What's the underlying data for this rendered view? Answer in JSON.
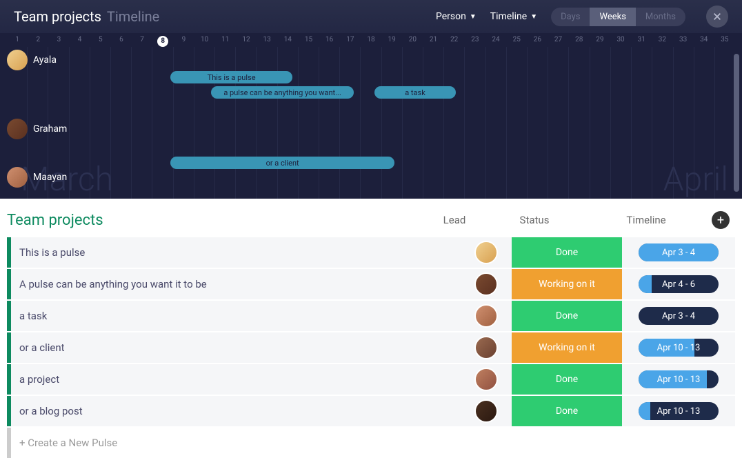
{
  "header": {
    "title": "Team projects",
    "subtitle": "Timeline",
    "dropdowns": {
      "person": "Person",
      "timeline": "Timeline"
    },
    "zoom": {
      "days": "Days",
      "weeks": "Weeks",
      "months": "Months",
      "active": "weeks"
    }
  },
  "timeline": {
    "days_start": 1,
    "days_end": 35,
    "current_day": 8,
    "left_month": "March",
    "right_month": "April",
    "people": [
      {
        "name": "Ayala"
      },
      {
        "name": "Graham"
      },
      {
        "name": "Maayan"
      }
    ],
    "bars": [
      {
        "label": "This is a pulse",
        "start": 9,
        "end": 15,
        "row": 0
      },
      {
        "label": "a pulse can be anything you want...",
        "start": 11,
        "end": 18,
        "row": 1
      },
      {
        "label": "a task",
        "start": 19,
        "end": 23,
        "row": 1
      },
      {
        "label": "or a client",
        "start": 9,
        "end": 20,
        "row": 3
      }
    ]
  },
  "board": {
    "title": "Team projects",
    "columns": {
      "lead": "Lead",
      "status": "Status",
      "timeline": "Timeline"
    },
    "rows": [
      {
        "title": "This is a pulse",
        "status_label": "Done",
        "status": "done",
        "date": "Apr 3 - 4",
        "progress": 100,
        "avatar": "av1"
      },
      {
        "title": "A pulse can be anything you want it to be",
        "status_label": "Working on it",
        "status": "working",
        "date": "Apr 4 - 6",
        "progress": 16,
        "avatar": "av2"
      },
      {
        "title": "a task",
        "status_label": "Done",
        "status": "done",
        "date": "Apr 3 - 4",
        "progress": 0,
        "avatar": "av3"
      },
      {
        "title": "or a client",
        "status_label": "Working on it",
        "status": "working",
        "date": "Apr 10 - 13",
        "progress": 70,
        "avatar": "av4"
      },
      {
        "title": "a project",
        "status_label": "Done",
        "status": "done",
        "date": "Apr 10 - 13",
        "progress": 85,
        "avatar": "av5"
      },
      {
        "title": "or a blog post",
        "status_label": "Done",
        "status": "done",
        "date": "Apr 10 - 13",
        "progress": 15,
        "avatar": "av6"
      }
    ],
    "new_pulse": "+ Create a New Pulse"
  }
}
